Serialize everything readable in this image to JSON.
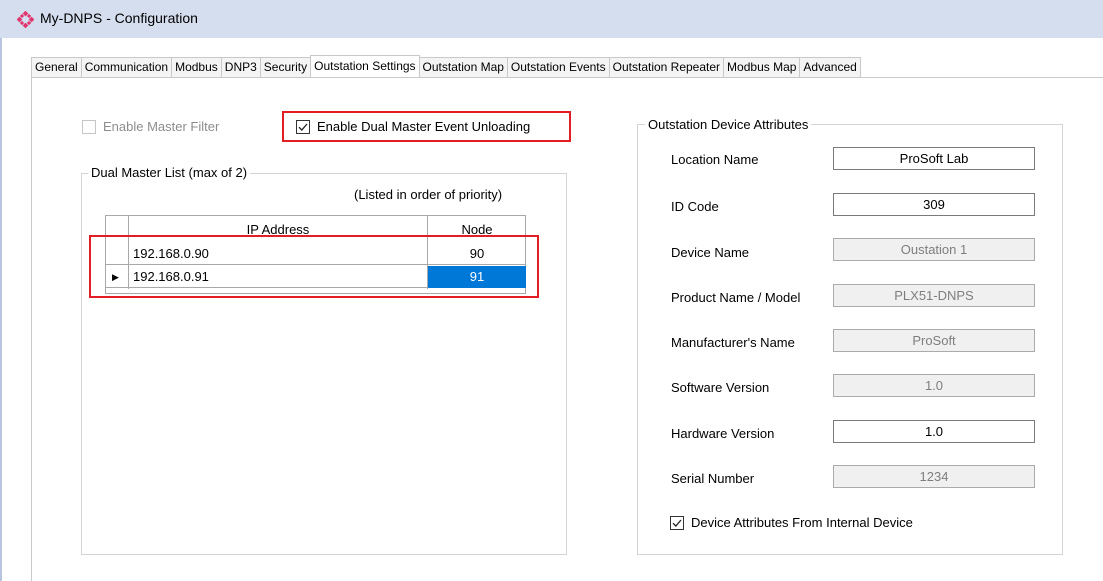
{
  "window": {
    "title": "My-DNPS - Configuration"
  },
  "tabs": [
    "General",
    "Communication",
    "Modbus",
    "DNP3",
    "Security",
    "Outstation Settings",
    "Outstation Map",
    "Outstation Events",
    "Outstation Repeater",
    "Modbus Map",
    "Advanced"
  ],
  "active_tab": "Outstation Settings",
  "left": {
    "enable_master_filter": {
      "label": "Enable Master Filter",
      "checked": false,
      "enabled": false
    },
    "enable_dual_master": {
      "label": "Enable Dual Master Event Unloading",
      "checked": true
    },
    "dual_master_group": {
      "title": "Dual Master List (max of 2)",
      "note": "(Listed in order of priority)",
      "columns": {
        "ip": "IP Address",
        "node": "Node"
      },
      "rows": [
        {
          "ip": "192.168.0.90",
          "node": "90",
          "selected": false
        },
        {
          "ip": "192.168.0.91",
          "node": "91",
          "selected": true
        }
      ]
    }
  },
  "right": {
    "group_title": "Outstation Device Attributes",
    "fields": [
      {
        "label": "Location Name",
        "value": "ProSoft Lab",
        "readonly": false
      },
      {
        "label": "ID Code",
        "value": "309",
        "readonly": false
      },
      {
        "label": "Device Name",
        "value": "Oustation 1",
        "readonly": true
      },
      {
        "label": "Product Name / Model",
        "value": "PLX51-DNPS",
        "readonly": true
      },
      {
        "label": "Manufacturer's Name",
        "value": "ProSoft",
        "readonly": true
      },
      {
        "label": "Software Version",
        "value": "1.0",
        "readonly": true
      },
      {
        "label": "Hardware Version",
        "value": "1.0",
        "readonly": false
      },
      {
        "label": "Serial Number",
        "value": "1234",
        "readonly": true
      }
    ],
    "internal_device": {
      "label": "Device Attributes From Internal Device",
      "checked": true
    }
  },
  "colors": {
    "titlebar": "#d5deee",
    "highlight": "#e31d24",
    "selection": "#0078d7"
  }
}
